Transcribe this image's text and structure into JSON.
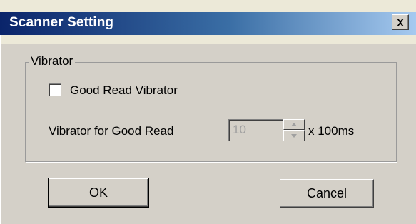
{
  "window": {
    "title": "Scanner Setting",
    "close_glyph": "X"
  },
  "group": {
    "label": "Vibrator"
  },
  "checkbox": {
    "label": "Good Read Vibrator",
    "checked": false
  },
  "vibrator_duration": {
    "label": "Vibrator for Good Read",
    "value": "10",
    "unit": "x 100ms",
    "enabled": false
  },
  "buttons": {
    "ok": "OK",
    "cancel": "Cancel"
  },
  "icons": {
    "close": "close-icon",
    "spin_up": "arrow-up-icon",
    "spin_down": "arrow-down-icon"
  },
  "colors": {
    "title_start": "#0a246a",
    "title_mid": "#3a6ea5",
    "title_end": "#a6caf0",
    "face": "#d4d0c8",
    "disabled_text": "#a0a0a0"
  }
}
